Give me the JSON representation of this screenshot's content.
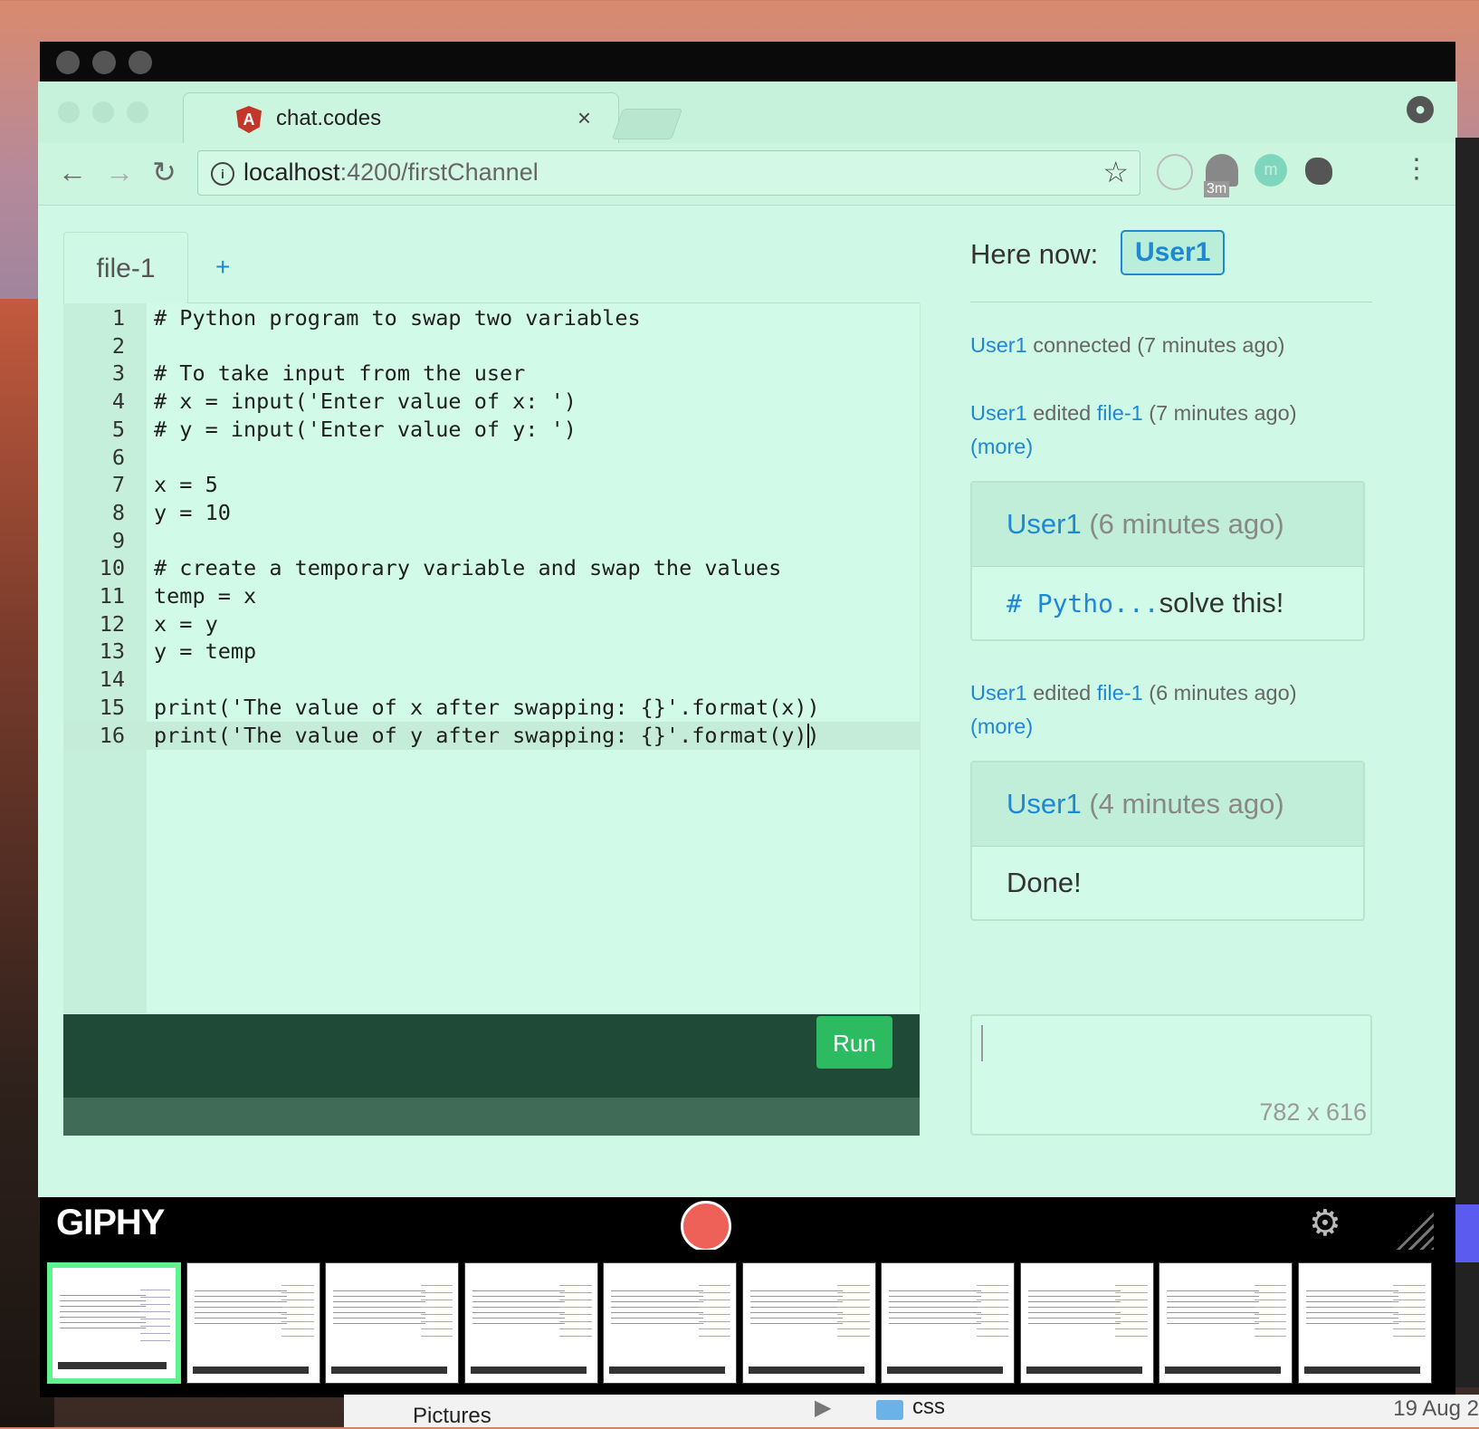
{
  "browser": {
    "tab_title": "chat.codes",
    "url_host": "localhost",
    "url_path": ":4200/firstChannel",
    "timer_badge": "3m",
    "ext_m_letter": "m"
  },
  "editor": {
    "file_tab": "file-1",
    "add_tab_label": "+",
    "lines": [
      {
        "n": "1",
        "code": "# Python program to swap two variables"
      },
      {
        "n": "2",
        "code": ""
      },
      {
        "n": "3",
        "code": "# To take input from the user"
      },
      {
        "n": "4",
        "code": "# x = input('Enter value of x: ')"
      },
      {
        "n": "5",
        "code": "# y = input('Enter value of y: ')"
      },
      {
        "n": "6",
        "code": ""
      },
      {
        "n": "7",
        "code": "x = 5"
      },
      {
        "n": "8",
        "code": "y = 10"
      },
      {
        "n": "9",
        "code": ""
      },
      {
        "n": "10",
        "code": "# create a temporary variable and swap the values"
      },
      {
        "n": "11",
        "code": "temp = x"
      },
      {
        "n": "12",
        "code": "x = y"
      },
      {
        "n": "13",
        "code": "y = temp"
      },
      {
        "n": "14",
        "code": ""
      },
      {
        "n": "15",
        "code": "print('The value of x after swapping: {}'.format(x))"
      },
      {
        "n": "16",
        "code": "print('The value of y after swapping: {}'.format(y))"
      }
    ],
    "run_label": "Run"
  },
  "sidebar": {
    "here_now_label": "Here now:",
    "present_user": "User1",
    "events": [
      {
        "user": "User1",
        "text": " connected (7 minutes ago)"
      },
      {
        "user": "User1",
        "text": " edited ",
        "file": "file-1",
        "time": " (7 minutes ago)",
        "more": "(more)"
      },
      {
        "user": "User1",
        "text": " edited ",
        "file": "file-1",
        "time": " (6 minutes ago)",
        "more": "(more)"
      }
    ],
    "messages": [
      {
        "user": "User1",
        "time": " (6 minutes ago)",
        "code_snippet": "# Pytho...",
        "body": "solve this!"
      },
      {
        "user": "User1",
        "time": " (4 minutes ago)",
        "body": "Done!"
      }
    ],
    "chat_input_size": "782 x 616"
  },
  "giphy": {
    "logo": "GIPHY"
  },
  "finder": {
    "pictures_label": "Pictures",
    "folder_label": "css",
    "date_label": "19 Aug 2"
  },
  "colors": {
    "page_bg": "#d0f8e6",
    "accent_blue": "#1e88d4",
    "run_green": "#2dbb62",
    "record_red": "#ee6158"
  }
}
